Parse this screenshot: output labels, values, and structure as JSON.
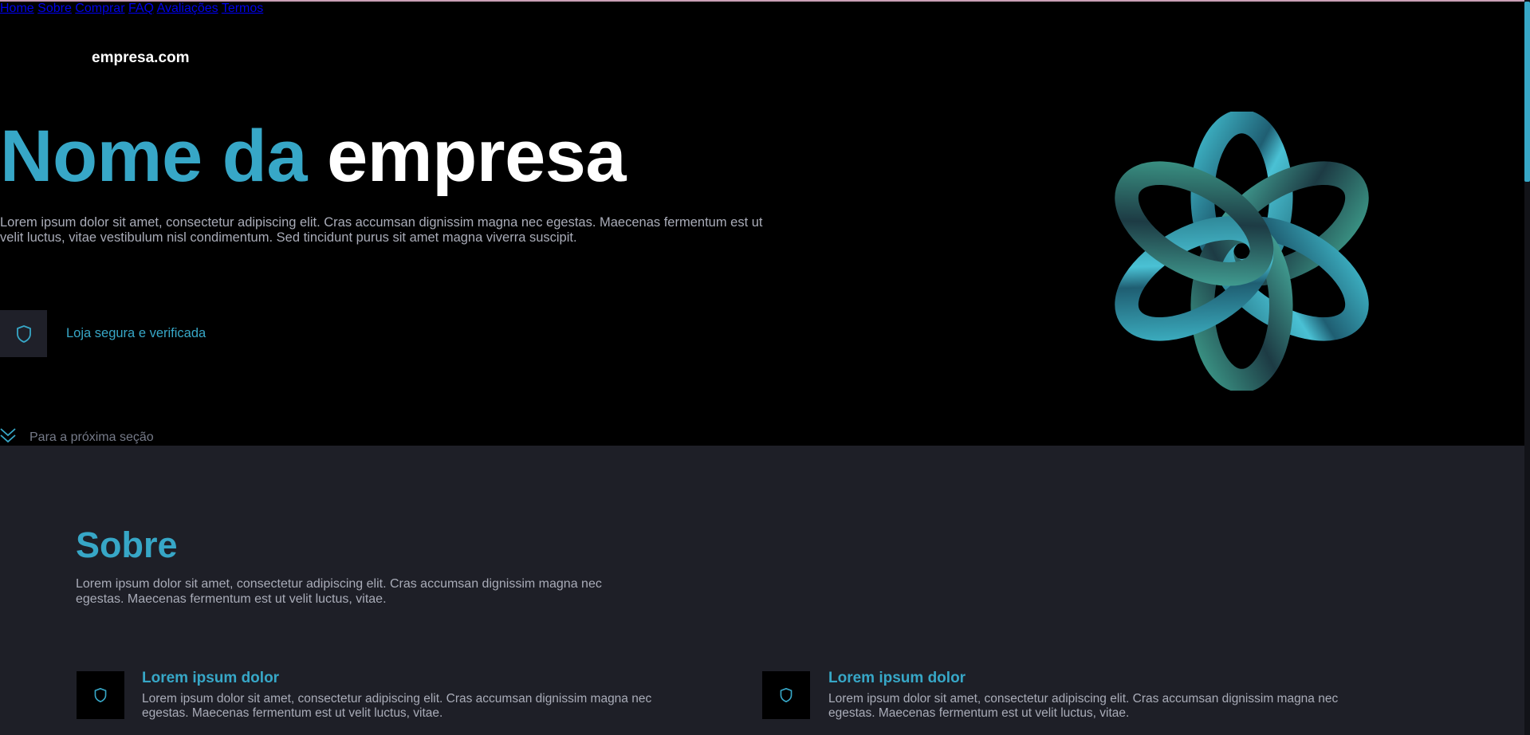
{
  "site": {
    "brand": "empresa.com"
  },
  "nav": {
    "items": [
      {
        "label": "Home",
        "active": true
      },
      {
        "label": "Sobre",
        "active": false
      },
      {
        "label": "Comprar",
        "active": false
      },
      {
        "label": "FAQ",
        "active": false
      },
      {
        "label": "Avaliações",
        "active": false
      },
      {
        "label": "Termos",
        "active": false
      }
    ]
  },
  "hero": {
    "title_part1": "Nome da",
    "title_part2": "empresa",
    "description": "Lorem ipsum dolor sit amet, consectetur adipiscing elit. Cras accumsan dignissim magna nec egestas. Maecenas fermentum est ut velit luctus, vitae vestibulum nisl condimentum. Sed tincidunt purus sit amet magna viverra suscipit.",
    "secure_label": "Loja segura e verificada",
    "next_section_label": "Para a próxima seção"
  },
  "about": {
    "title": "Sobre",
    "description": "Lorem ipsum dolor sit amet, consectetur adipiscing elit. Cras accumsan dignissim magna nec egestas. Maecenas fermentum est ut velit luctus, vitae.",
    "cards": [
      {
        "title": "Lorem ipsum dolor",
        "text": "Lorem ipsum dolor sit amet, consectetur adipiscing elit. Cras accumsan dignissim magna nec egestas. Maecenas fermentum est ut velit luctus, vitae."
      },
      {
        "title": "Lorem ipsum dolor",
        "text": "Lorem ipsum dolor sit amet, consectetur adipiscing elit. Cras accumsan dignissim magna nec egestas. Maecenas fermentum est ut velit luctus, vitae."
      }
    ]
  },
  "icons": {
    "secure": "shield-icon",
    "next": "double-chevron-down-icon",
    "card": "shield-icon"
  },
  "colors": {
    "accent": "#37a7c7",
    "hero_bg": "#000000",
    "section_bg": "#1e1f27",
    "text_muted": "#a9acb8"
  }
}
